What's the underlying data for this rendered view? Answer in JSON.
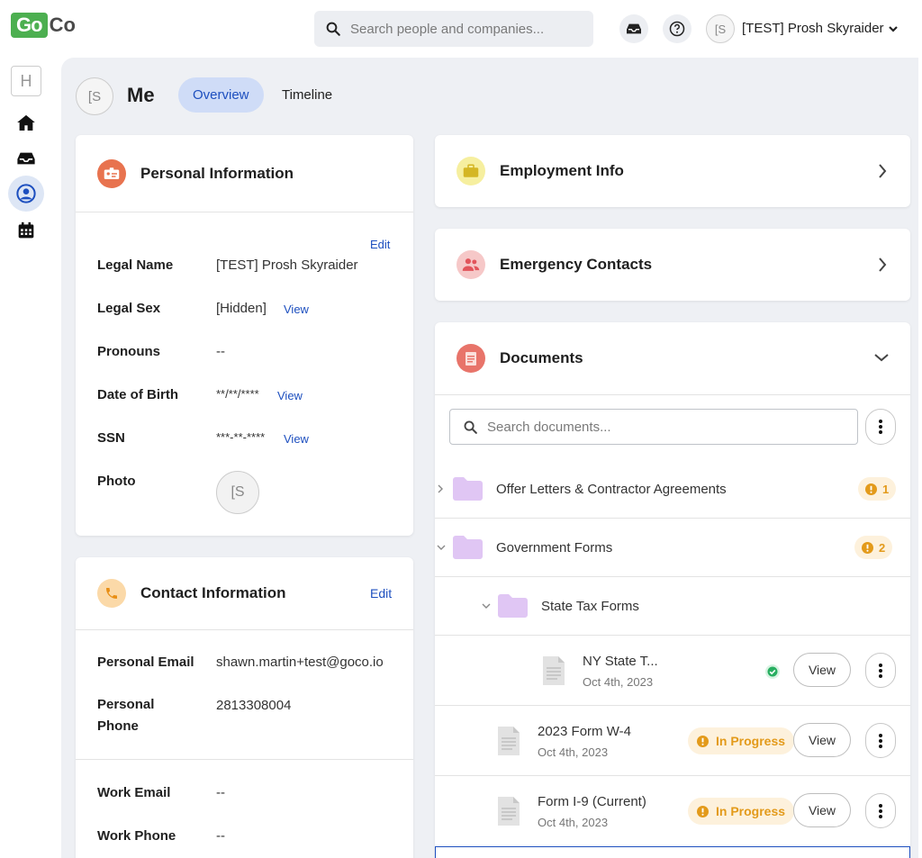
{
  "header": {
    "logo_left": "Go",
    "logo_right": "Co",
    "search_placeholder": "Search people and companies...",
    "user_initial": "[S",
    "user_name": "[TEST] Prosh Skyraider"
  },
  "rail": {
    "org_initial": "H"
  },
  "page": {
    "avatar_initial": "[S",
    "title": "Me",
    "tabs": [
      {
        "label": "Overview"
      },
      {
        "label": "Timeline"
      }
    ]
  },
  "personal": {
    "title": "Personal Information",
    "edit": "Edit",
    "fields": [
      {
        "label": "Legal Name",
        "value": "[TEST] Prosh Skyraider"
      },
      {
        "label": "Legal Sex",
        "value": "[Hidden]",
        "link": "View"
      },
      {
        "label": "Pronouns",
        "value": "--"
      },
      {
        "label": "Date of Birth",
        "value": "**/**/****",
        "link": "View"
      },
      {
        "label": "SSN",
        "value": "***-**-****",
        "link": "View"
      },
      {
        "label": "Photo",
        "value": "[S"
      }
    ]
  },
  "contact": {
    "title": "Contact Information",
    "edit": "Edit",
    "fields": [
      {
        "label": "Personal Email",
        "value": "shawn.martin+test@goco.io"
      },
      {
        "label": "Personal Phone",
        "value": "2813308004"
      },
      {
        "label": "Work Email",
        "value": "--"
      },
      {
        "label": "Work Phone",
        "value": "--"
      }
    ]
  },
  "employment": {
    "title": "Employment Info"
  },
  "emergency": {
    "title": "Emergency Contacts"
  },
  "documents": {
    "title": "Documents",
    "search_placeholder": "Search documents...",
    "folders": [
      {
        "name": "Offer Letters & Contractor Agreements",
        "count": "1"
      },
      {
        "name": "Government Forms",
        "count": "2"
      },
      {
        "name": "State Tax Forms"
      }
    ],
    "files": [
      {
        "name": "NY State T...",
        "date": "Oct 4th, 2023",
        "view": "View"
      },
      {
        "name": "2023 Form W-4",
        "date": "Oct 4th, 2023",
        "status": "In Progress",
        "view": "View"
      },
      {
        "name": "Form I-9 (Current)",
        "date": "Oct 4th, 2023",
        "status": "In Progress",
        "view": "View"
      }
    ]
  },
  "colors": {
    "accent": "#1d4fbf",
    "warning": "#e39a1a",
    "success": "#27ae60",
    "brand_green": "#4caf50"
  }
}
